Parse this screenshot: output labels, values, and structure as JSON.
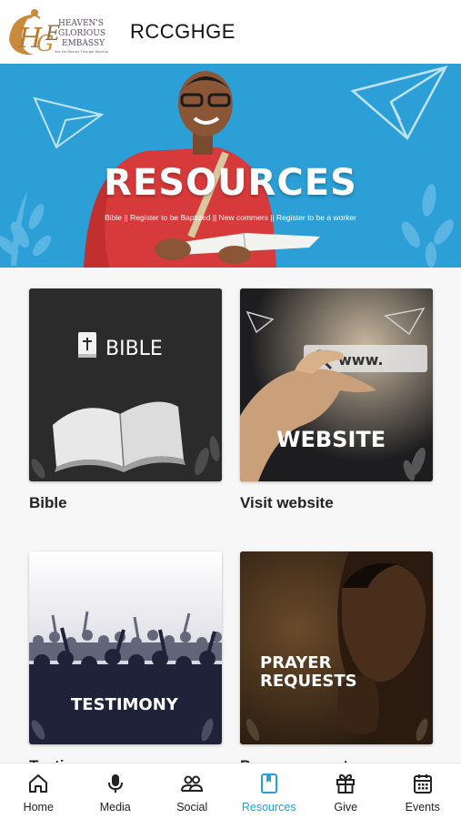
{
  "header": {
    "app_title": "RCCGHGE",
    "logo": {
      "initials": "HGE",
      "line1": "HEAVEN'S",
      "line2": "GLORIOUS",
      "line3": "EMBASSY",
      "tagline": "See His Beauty Through Worship"
    }
  },
  "banner": {
    "title": "RESOURCES",
    "subtitle": "Bible || Register to be Baptized || New commers || Register to be a worker",
    "color": "#2b9fd6"
  },
  "cards": [
    {
      "label": "Bible",
      "image_text": "BIBLE"
    },
    {
      "label": "Visit website",
      "image_text": "WEBSITE",
      "search_text": "www."
    },
    {
      "label": "Testimony",
      "image_text": "TESTIMONY"
    },
    {
      "label": "Prayer request",
      "image_text_line1": "PRAYER",
      "image_text_line2": "REQUESTS"
    }
  ],
  "nav": {
    "items": [
      {
        "label": "Home",
        "icon": "home-icon"
      },
      {
        "label": "Media",
        "icon": "microphone-icon"
      },
      {
        "label": "Social",
        "icon": "people-icon"
      },
      {
        "label": "Resources",
        "icon": "book-icon",
        "active": true
      },
      {
        "label": "Give",
        "icon": "gift-icon"
      },
      {
        "label": "Events",
        "icon": "calendar-icon"
      }
    ],
    "active_color": "#2a9fd6"
  }
}
